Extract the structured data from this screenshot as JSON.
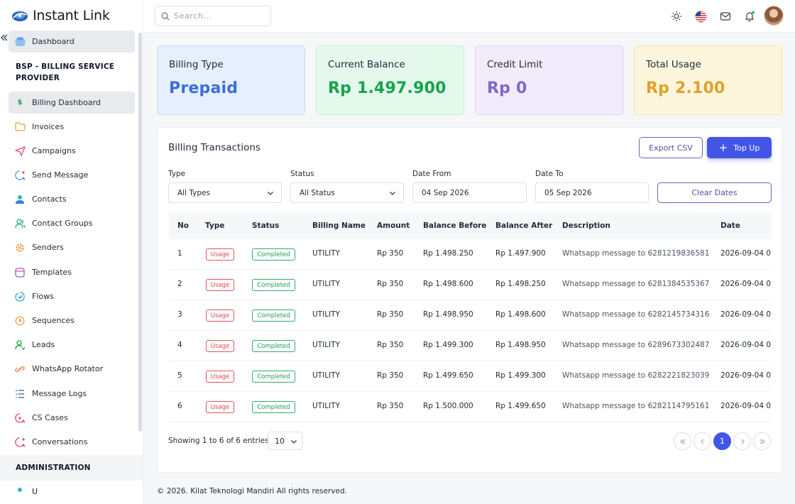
{
  "brand": {
    "name": "Instant Link"
  },
  "sidebar": {
    "dashboard": "Dashboard",
    "section_bsp": "BSP - BILLING SERVICE PROVIDER",
    "items": [
      {
        "label": "Billing Dashboard",
        "icon": "dollar-icon"
      },
      {
        "label": "Invoices",
        "icon": "folder-icon"
      },
      {
        "label": "Campaigns",
        "icon": "send-icon"
      },
      {
        "label": "Send Message",
        "icon": "chat-icon"
      },
      {
        "label": "Contacts",
        "icon": "user-icon"
      },
      {
        "label": "Contact Groups",
        "icon": "users-icon"
      },
      {
        "label": "Senders",
        "icon": "gear-icon"
      },
      {
        "label": "Templates",
        "icon": "template-icon"
      },
      {
        "label": "Flows",
        "icon": "flow-icon"
      },
      {
        "label": "Sequences",
        "icon": "clock-icon"
      },
      {
        "label": "Leads",
        "icon": "lead-icon"
      },
      {
        "label": "WhatsApp Rotator",
        "icon": "link-icon"
      },
      {
        "label": "Message Logs",
        "icon": "list-icon"
      },
      {
        "label": "CS Cases",
        "icon": "case-icon"
      },
      {
        "label": "Conversations",
        "icon": "conversation-icon"
      }
    ],
    "section_admin": "ADMINISTRATION",
    "partial_item": "U"
  },
  "header": {
    "search_placeholder": "Search..."
  },
  "stats": [
    {
      "label": "Billing Type",
      "value": "Prepaid",
      "color": "#3b6fd6",
      "bg": "#e6effd",
      "border": "#c7d9f6"
    },
    {
      "label": "Current Balance",
      "value": "Rp 1.497.900",
      "color": "#17a34a",
      "bg": "#e4f8ec",
      "border": "#c5edd4"
    },
    {
      "label": "Credit Limit",
      "value": "Rp 0",
      "color": "#8068c9",
      "bg": "#f1ebfc",
      "border": "#ddd0f4"
    },
    {
      "label": "Total Usage",
      "value": "Rp 2.100",
      "color": "#e0a12a",
      "bg": "#fdf6dc",
      "border": "#f3e3a7"
    }
  ],
  "transactions": {
    "title": "Billing Transactions",
    "export_label": "Export CSV",
    "topup_label": "Top Up",
    "filters": {
      "type_label": "Type",
      "type_value": "All Types",
      "status_label": "Status",
      "status_value": "All Status",
      "date_from_label": "Date From",
      "date_from_value": "04 Sep 2026",
      "date_to_label": "Date To",
      "date_to_value": "05 Sep 2026",
      "clear_label": "Clear Dates"
    },
    "columns": [
      "No",
      "Type",
      "Status",
      "Billing Name",
      "Amount",
      "Balance Before",
      "Balance After",
      "Description",
      "Date"
    ],
    "rows": [
      {
        "no": "1",
        "type": "Usage",
        "status": "Completed",
        "billing_name": "UTILITY",
        "amount": "Rp 350",
        "before": "Rp 1.498.250",
        "after": "Rp 1.497.900",
        "desc": "Whatsapp message to 6281219836581",
        "date": "2026-09-04 0"
      },
      {
        "no": "2",
        "type": "Usage",
        "status": "Completed",
        "billing_name": "UTILITY",
        "amount": "Rp 350",
        "before": "Rp 1.498.600",
        "after": "Rp 1.498.250",
        "desc": "Whatsapp message to 6281384535367",
        "date": "2026-09-04 0"
      },
      {
        "no": "3",
        "type": "Usage",
        "status": "Completed",
        "billing_name": "UTILITY",
        "amount": "Rp 350",
        "before": "Rp 1.498.950",
        "after": "Rp 1.498.600",
        "desc": "Whatsapp message to 6282145734316",
        "date": "2026-09-04 0"
      },
      {
        "no": "4",
        "type": "Usage",
        "status": "Completed",
        "billing_name": "UTILITY",
        "amount": "Rp 350",
        "before": "Rp 1.499.300",
        "after": "Rp 1.498.950",
        "desc": "Whatsapp message to 6289673302487",
        "date": "2026-09-04 0"
      },
      {
        "no": "5",
        "type": "Usage",
        "status": "Completed",
        "billing_name": "UTILITY",
        "amount": "Rp 350",
        "before": "Rp 1.499.650",
        "after": "Rp 1.499.300",
        "desc": "Whatsapp message to 6282221823039",
        "date": "2026-09-04 0"
      },
      {
        "no": "6",
        "type": "Usage",
        "status": "Completed",
        "billing_name": "UTILITY",
        "amount": "Rp 350",
        "before": "Rp 1.500.000",
        "after": "Rp 1.499.650",
        "desc": "Whatsapp message to 6282114795161",
        "date": "2026-09-04 0"
      }
    ],
    "showing": "Showing 1 to 6 of 6 entries",
    "page_size": "10",
    "current_page": "1"
  },
  "footer": {
    "copyright": "© 2026. Kilat Teknologi Mandiri All rights reserved."
  }
}
